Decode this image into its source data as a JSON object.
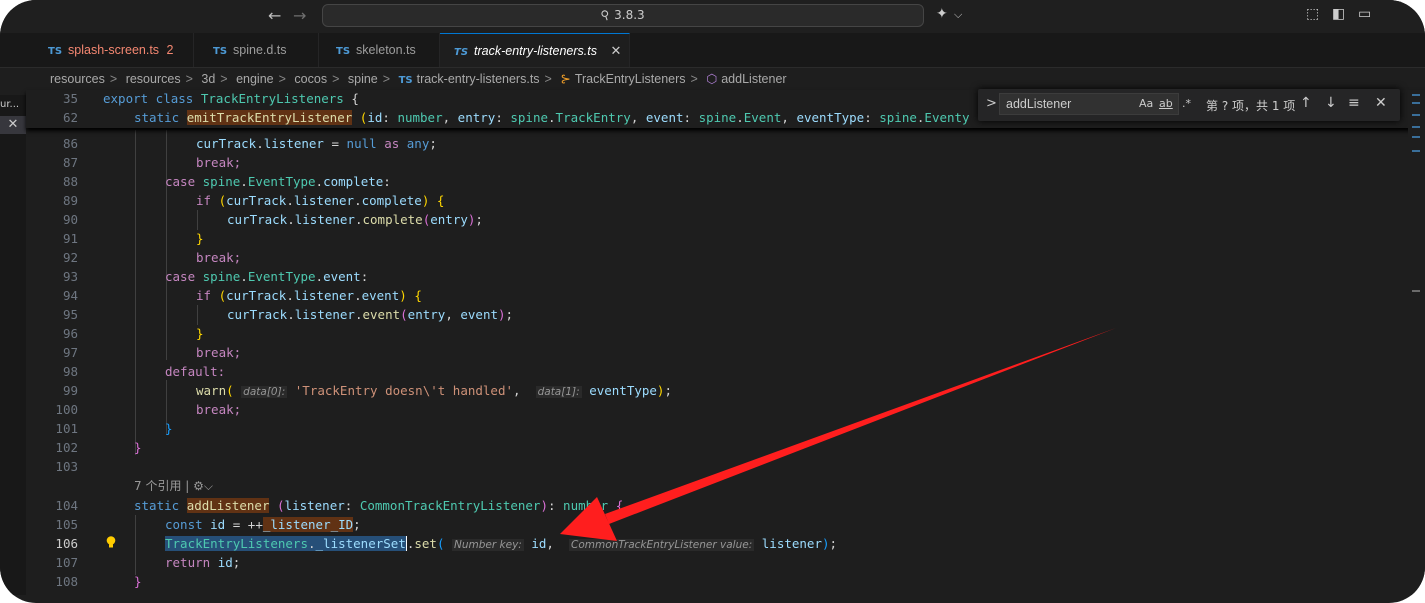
{
  "titlebar": {
    "back_icon": "←",
    "forward_icon": "→",
    "search_text": "3.8.3",
    "copilot_icon": "✦",
    "copilot_chevron": "⌵",
    "layout_icons": [
      "⬚",
      "◧",
      "▭"
    ]
  },
  "tabs": [
    {
      "lang": "TS",
      "label": "splash-screen.ts",
      "badge": "2"
    },
    {
      "lang": "TS",
      "label": "spine.d.ts"
    },
    {
      "lang": "TS",
      "label": "skeleton.ts"
    },
    {
      "lang": "TS",
      "label": "track-entry-listeners.ts",
      "close": "✕"
    }
  ],
  "breadcrumb": {
    "items": [
      "resources",
      "resources",
      "3d",
      "engine",
      "cocos",
      "spine"
    ],
    "file_lang": "TS",
    "file": "track-entry-listeners.ts",
    "class": "TrackEntryListeners",
    "method": "addListener",
    "sep": ">"
  },
  "left_sliver": {
    "text": "ur...",
    "close": "✕"
  },
  "find": {
    "chevron": ">",
    "value": "addListener",
    "options": [
      "Aa",
      "ab",
      ".*"
    ],
    "count": "第 ? 项，共 1 项",
    "prev": "↑",
    "next": "↓",
    "menu": "≡",
    "close": "✕"
  },
  "editor": {
    "line_numbers": [
      "35",
      "62",
      "86",
      "87",
      "88",
      "89",
      "90",
      "91",
      "92",
      "93",
      "94",
      "95",
      "96",
      "97",
      "98",
      "99",
      "100",
      "101",
      "102",
      "103",
      "104",
      "105",
      "106",
      "107",
      "108"
    ],
    "codelens": "7 个引用 | ",
    "codelens_icon": "⚙",
    "code": {
      "l35": {
        "kw": "export class ",
        "cls": "TrackEntryListeners",
        "rest": " {"
      },
      "l62": {
        "kw": "static ",
        "fn": "emitTrackEntryListener",
        "p1": "id",
        "t1": "number",
        "p2": "entry",
        "ns2": "spine",
        "t2": "TrackEntry",
        "p3": "event",
        "ns3": "spine",
        "t3": "Event",
        "p4": "eventType",
        "ns4": "spine",
        "t4": "Eventy"
      },
      "l86": {
        "obj": "curTrack",
        "prop": "listener",
        "null": "null",
        "as": "as",
        "any": "any"
      },
      "l87": "break;",
      "l88": {
        "kw": "case ",
        "ns": "spine",
        "t": "EventType",
        "prop": "complete"
      },
      "l89": {
        "kw": "if ",
        "obj": "curTrack",
        "prop": "listener",
        "m": "complete"
      },
      "l90": {
        "obj": "curTrack",
        "prop": "listener",
        "m": "complete",
        "arg": "entry"
      },
      "l91": "}",
      "l92": "break;",
      "l93": {
        "kw": "case ",
        "ns": "spine",
        "t": "EventType",
        "prop": "event"
      },
      "l94": {
        "kw": "if ",
        "obj": "curTrack",
        "prop": "listener",
        "m": "event"
      },
      "l95": {
        "obj": "curTrack",
        "prop": "listener",
        "m": "event",
        "a1": "entry",
        "a2": "event"
      },
      "l96": "}",
      "l97": "break;",
      "l98": "default:",
      "l99": {
        "fn": "warn",
        "h1": "data[0]:",
        "str": "'TrackEntry doesn\\'t handled'",
        "h2": "data[1]:",
        "arg": "eventType"
      },
      "l100": "break;",
      "l101": "}",
      "l102": "}",
      "l104": {
        "kw": "static ",
        "fn": "addListener",
        "p": "listener",
        "t": "CommonTrackEntryListener",
        "rt": "number"
      },
      "l105": {
        "kw": "const ",
        "v": "id",
        "op": " = ++",
        "g": "_listener_ID"
      },
      "l106": {
        "cls": "TrackEntryListeners",
        "prop": "_listenerSet",
        "m": "set",
        "h1": "Number key:",
        "a1": "id",
        "h2": "CommonTrackEntryListener value:",
        "a2": "listener"
      },
      "l107": {
        "kw": "return ",
        "v": "id"
      },
      "l108": "}"
    }
  },
  "colors": {
    "accent": "#0078d4",
    "arrow": "#ff1e1e",
    "bg": "#1e1e1e"
  }
}
